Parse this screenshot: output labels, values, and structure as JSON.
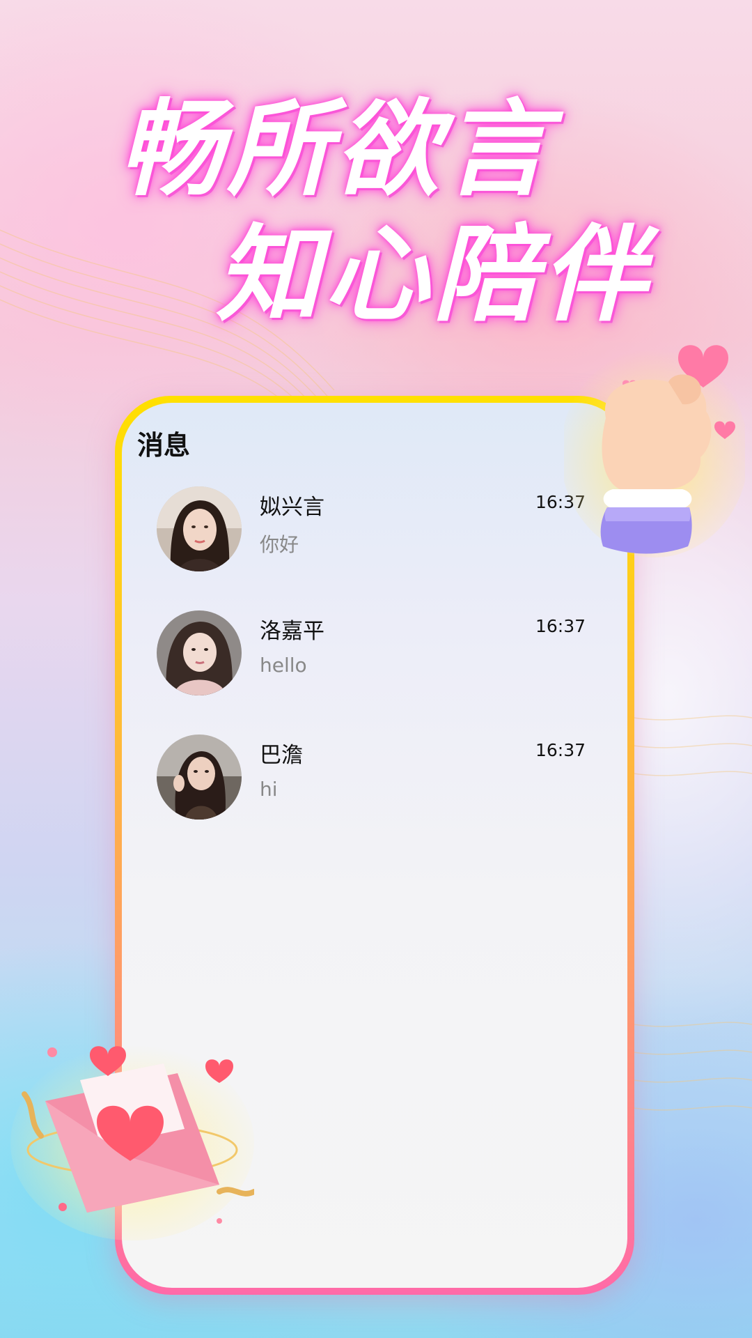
{
  "headline": {
    "line1": "畅所欲言",
    "line2": "知心陪伴"
  },
  "screen": {
    "title": "消息"
  },
  "messages": [
    {
      "name": "姒兴言",
      "preview": "你好",
      "time": "16:37"
    },
    {
      "name": "洛嘉平",
      "preview": "hello",
      "time": "16:37"
    },
    {
      "name": "巴澹",
      "preview": "hi",
      "time": "16:37"
    }
  ],
  "colors": {
    "frame_top": "#ffe000",
    "frame_bottom": "#ff6aa8",
    "headline_glow": "#ff4fd8"
  },
  "icons": [
    "heart-hand-icon",
    "love-letter-envelope-icon",
    "avatar-photo"
  ]
}
